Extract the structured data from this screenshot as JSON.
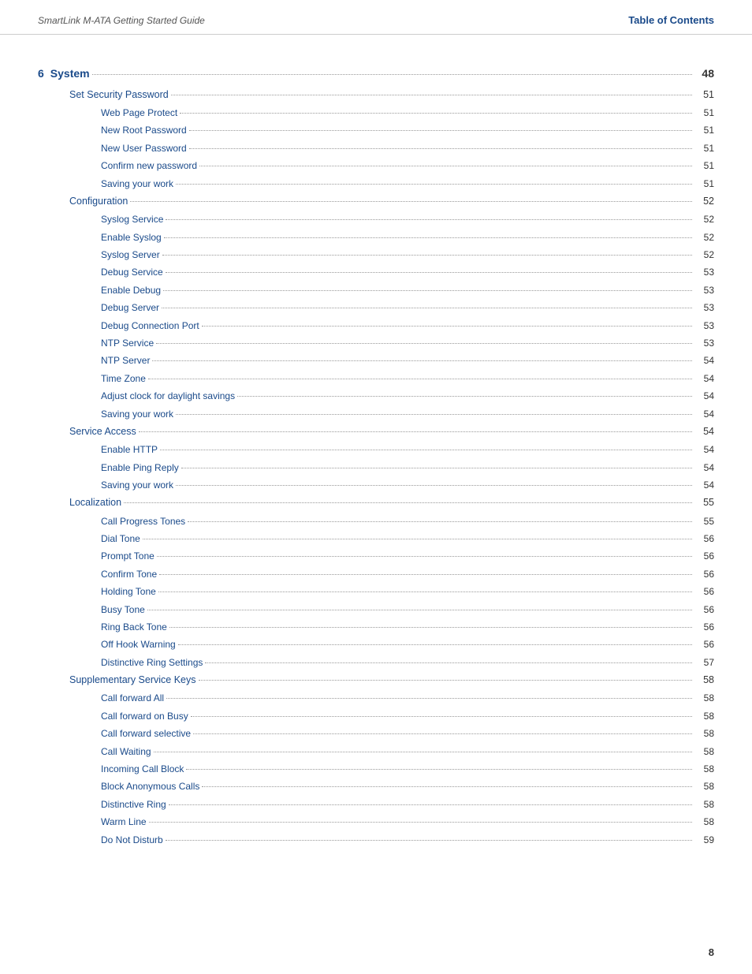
{
  "header": {
    "left": "SmartLink M-ATA Getting Started Guide",
    "right": "Table of Contents"
  },
  "chapter": {
    "number": "6",
    "label": "System",
    "page": "48"
  },
  "entries": [
    {
      "level": 2,
      "label": "Set Security Password",
      "page": "51"
    },
    {
      "level": 3,
      "label": "Web Page Protect",
      "page": "51"
    },
    {
      "level": 3,
      "label": "New Root Password",
      "page": "51"
    },
    {
      "level": 3,
      "label": "New User Password",
      "page": "51"
    },
    {
      "level": 3,
      "label": "Confirm new password",
      "page": "51"
    },
    {
      "level": 3,
      "label": "Saving your work",
      "page": "51"
    },
    {
      "level": 2,
      "label": "Configuration",
      "page": "52"
    },
    {
      "level": 3,
      "label": "Syslog Service",
      "page": "52"
    },
    {
      "level": 3,
      "label": "Enable Syslog",
      "page": "52"
    },
    {
      "level": 3,
      "label": "Syslog Server",
      "page": "52"
    },
    {
      "level": 3,
      "label": "Debug Service",
      "page": "53"
    },
    {
      "level": 3,
      "label": "Enable Debug",
      "page": "53"
    },
    {
      "level": 3,
      "label": "Debug Server",
      "page": "53"
    },
    {
      "level": 3,
      "label": "Debug Connection Port",
      "page": "53"
    },
    {
      "level": 3,
      "label": "NTP Service",
      "page": "53"
    },
    {
      "level": 3,
      "label": "NTP Server",
      "page": "54"
    },
    {
      "level": 3,
      "label": "Time Zone",
      "page": "54"
    },
    {
      "level": 3,
      "label": "Adjust clock for daylight savings",
      "page": "54"
    },
    {
      "level": 3,
      "label": "Saving your work",
      "page": "54"
    },
    {
      "level": 2,
      "label": "Service Access",
      "page": "54"
    },
    {
      "level": 3,
      "label": "Enable HTTP",
      "page": "54"
    },
    {
      "level": 3,
      "label": "Enable Ping Reply",
      "page": "54"
    },
    {
      "level": 3,
      "label": "Saving your work",
      "page": "54"
    },
    {
      "level": 2,
      "label": "Localization",
      "page": "55"
    },
    {
      "level": 3,
      "label": "Call Progress Tones",
      "page": "55"
    },
    {
      "level": 3,
      "label": "Dial Tone",
      "page": "56"
    },
    {
      "level": 3,
      "label": "Prompt Tone",
      "page": "56"
    },
    {
      "level": 3,
      "label": "Confirm Tone",
      "page": "56"
    },
    {
      "level": 3,
      "label": "Holding Tone",
      "page": "56"
    },
    {
      "level": 3,
      "label": "Busy Tone",
      "page": "56"
    },
    {
      "level": 3,
      "label": "Ring Back Tone",
      "page": "56"
    },
    {
      "level": 3,
      "label": "Off Hook Warning",
      "page": "56"
    },
    {
      "level": 3,
      "label": "Distinctive Ring Settings",
      "page": "57"
    },
    {
      "level": 2,
      "label": "Supplementary Service Keys",
      "page": "58"
    },
    {
      "level": 3,
      "label": "Call forward All",
      "page": "58"
    },
    {
      "level": 3,
      "label": "Call forward on Busy",
      "page": "58"
    },
    {
      "level": 3,
      "label": "Call forward selective",
      "page": "58"
    },
    {
      "level": 3,
      "label": "Call Waiting",
      "page": "58"
    },
    {
      "level": 3,
      "label": "Incoming Call Block",
      "page": "58"
    },
    {
      "level": 3,
      "label": "Block Anonymous Calls",
      "page": "58"
    },
    {
      "level": 3,
      "label": "Distinctive Ring",
      "page": "58"
    },
    {
      "level": 3,
      "label": "Warm Line",
      "page": "58"
    },
    {
      "level": 3,
      "label": "Do Not Disturb",
      "page": "59"
    }
  ],
  "footer": {
    "page": "8"
  }
}
